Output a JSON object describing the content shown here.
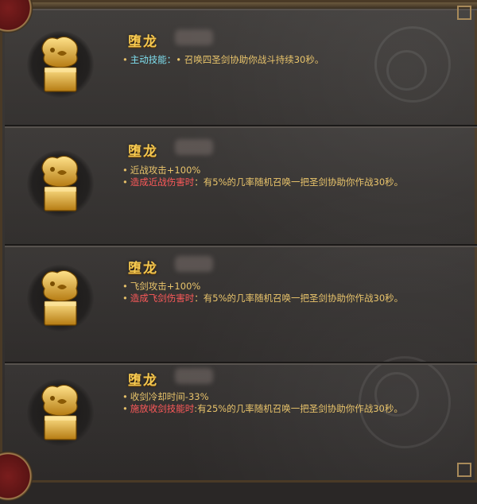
{
  "cards": [
    {
      "title": "堕龙",
      "lines": [
        {
          "label": "主动技能：",
          "value": "• 召唤四圣剑协助你战斗持续30秒。",
          "label_color": "cyan"
        }
      ]
    },
    {
      "title": "堕龙",
      "lines": [
        {
          "label": "",
          "value": "近战攻击+100%"
        },
        {
          "label": "造成近战伤害时",
          "value": "：有5%的几率随机召唤一把圣剑协助你作战30秒。",
          "label_color": "red"
        }
      ]
    },
    {
      "title": "堕龙",
      "lines": [
        {
          "label": "",
          "value": "飞剑攻击+100%"
        },
        {
          "label": "造成飞剑伤害时",
          "value": "：有5%的几率随机召唤一把圣剑协助你作战30秒。",
          "label_color": "red"
        }
      ]
    },
    {
      "title": "堕龙",
      "lines": [
        {
          "label": "",
          "value": "收剑冷却时间-33%"
        },
        {
          "label": "施放收剑技能时",
          "value": ":有25%的几率随机召唤一把圣剑协助你作战30秒。",
          "label_color": "red"
        }
      ]
    }
  ],
  "colors": {
    "title": "#f3c851",
    "text": "#e5bf68",
    "label_cyan": "#7fe0f0",
    "label_red": "#ff5a5a"
  },
  "icon": "golden-dragon-seal-icon"
}
